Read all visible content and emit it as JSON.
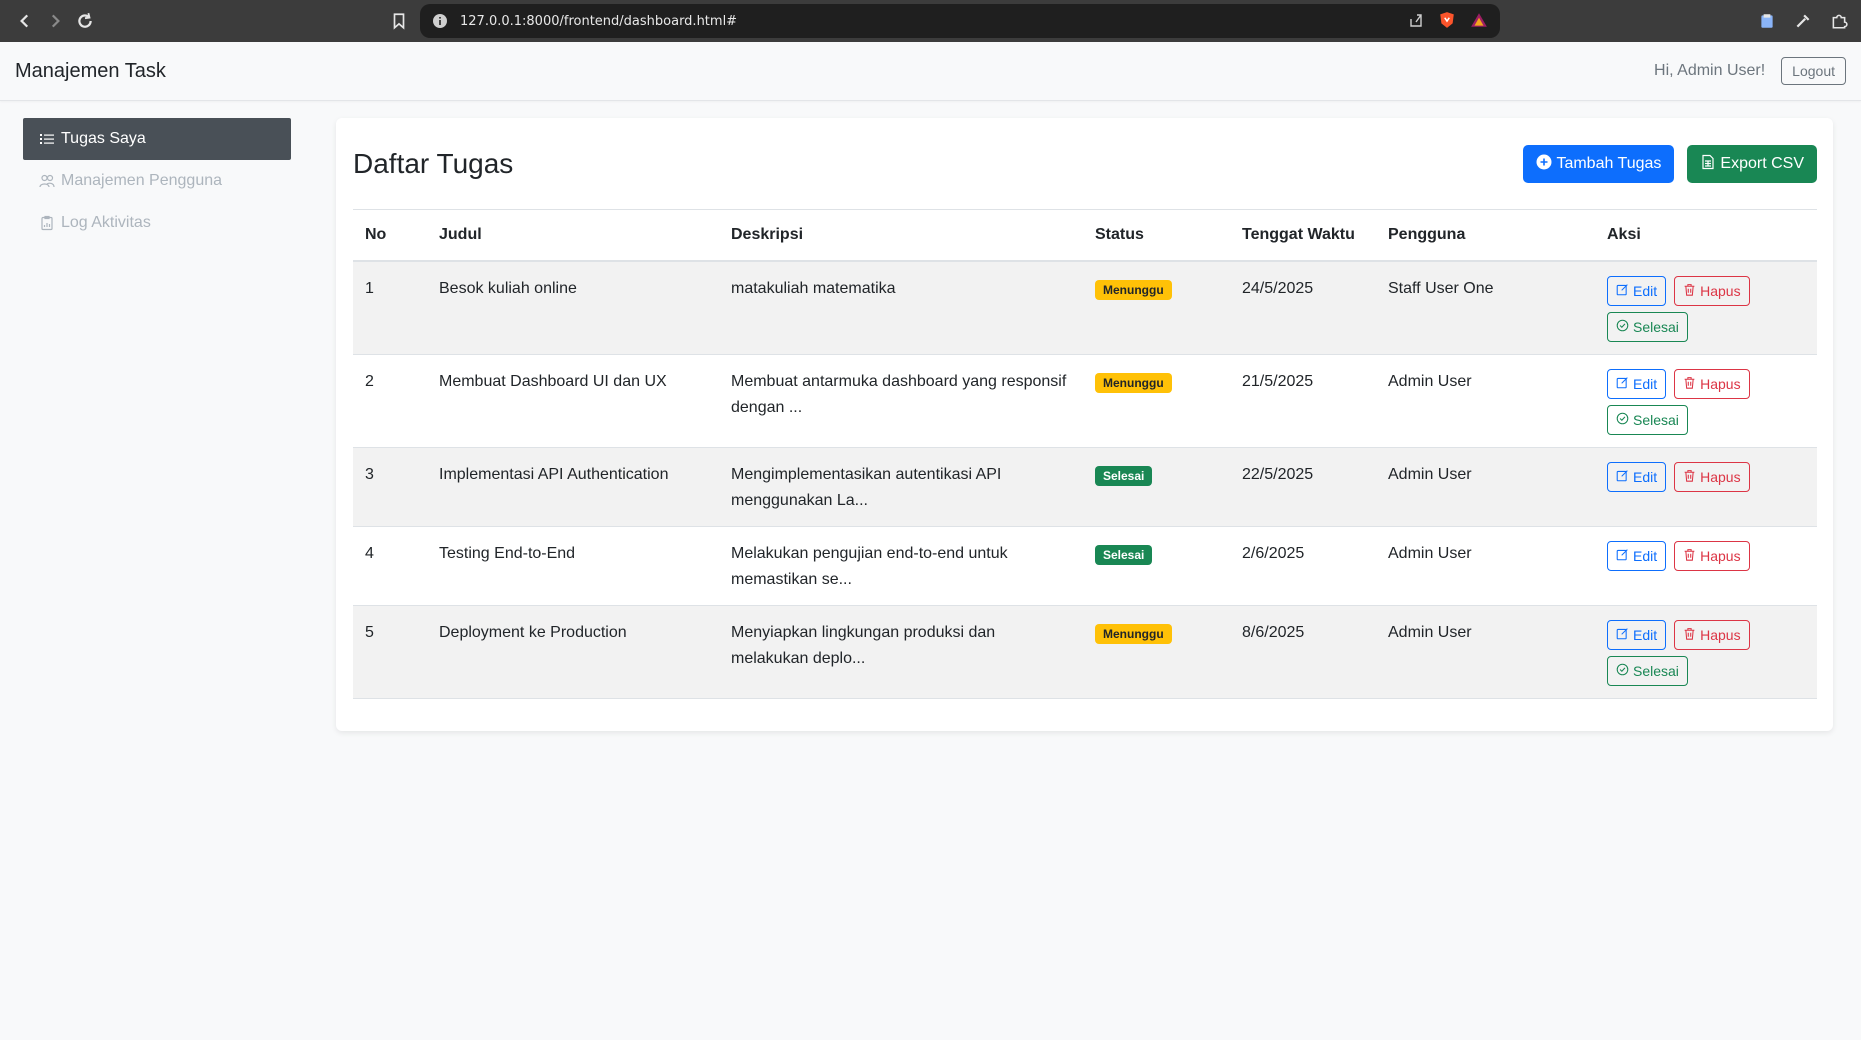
{
  "browser": {
    "url": "127.0.0.1:8000/frontend/dashboard.html#"
  },
  "navbar": {
    "brand": "Manajemen Task",
    "greeting": "Hi, Admin User!",
    "logout_label": "Logout"
  },
  "sidebar": {
    "items": [
      {
        "label": "Tugas Saya",
        "icon": "list-icon",
        "active": true
      },
      {
        "label": "Manajemen Pengguna",
        "icon": "users-icon",
        "active": false
      },
      {
        "label": "Log Aktivitas",
        "icon": "clipboard-icon",
        "active": false
      }
    ]
  },
  "main": {
    "title": "Daftar Tugas",
    "add_button_label": "Tambah Tugas",
    "export_button_label": "Export CSV",
    "table": {
      "headers": [
        "No",
        "Judul",
        "Deskripsi",
        "Status",
        "Tenggat Waktu",
        "Pengguna",
        "Aksi"
      ],
      "rows": [
        {
          "no": "1",
          "judul": "Besok kuliah online",
          "deskripsi": "matakuliah matematika",
          "status": "Menunggu",
          "tenggat": "24/5/2025",
          "pengguna": "Staff User One"
        },
        {
          "no": "2",
          "judul": "Membuat Dashboard UI dan UX",
          "deskripsi": "Membuat antarmuka dashboard yang responsif dengan ...",
          "status": "Menunggu",
          "tenggat": "21/5/2025",
          "pengguna": "Admin User"
        },
        {
          "no": "3",
          "judul": "Implementasi API Authentication",
          "deskripsi": "Mengimplementasikan autentikasi API menggunakan La...",
          "status": "Selesai",
          "tenggat": "22/5/2025",
          "pengguna": "Admin User"
        },
        {
          "no": "4",
          "judul": "Testing End-to-End",
          "deskripsi": "Melakukan pengujian end-to-end untuk memastikan se...",
          "status": "Selesai",
          "tenggat": "2/6/2025",
          "pengguna": "Admin User"
        },
        {
          "no": "5",
          "judul": "Deployment ke Production",
          "deskripsi": "Menyiapkan lingkungan produksi dan melakukan deplo...",
          "status": "Menunggu",
          "tenggat": "8/6/2025",
          "pengguna": "Admin User"
        }
      ],
      "actions": {
        "edit": "Edit",
        "delete": "Hapus",
        "done": "Selesai"
      }
    }
  },
  "colors": {
    "primary": "#0d6efd",
    "success": "#198754",
    "danger": "#dc3545",
    "warning": "#ffc107",
    "sidebar_active": "#495057"
  }
}
